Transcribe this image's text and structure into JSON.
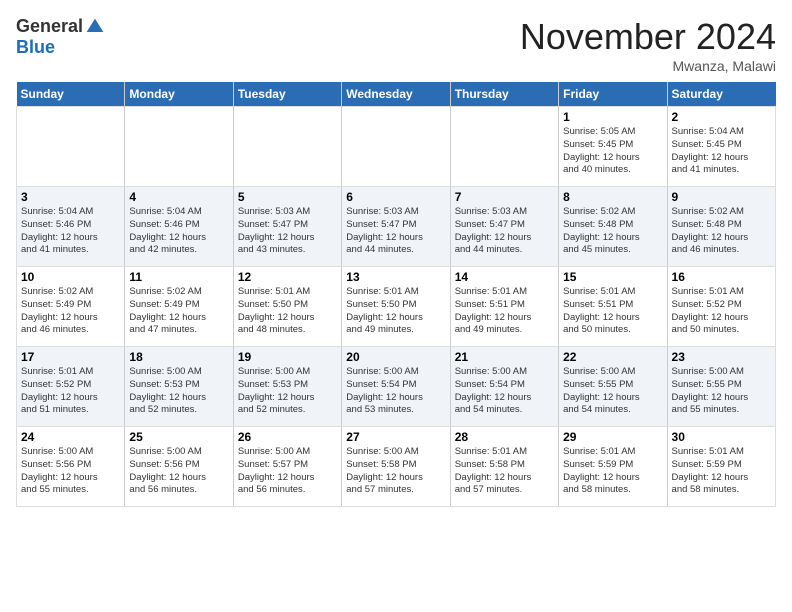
{
  "header": {
    "logo_general": "General",
    "logo_blue": "Blue",
    "month_title": "November 2024",
    "location": "Mwanza, Malawi"
  },
  "weekdays": [
    "Sunday",
    "Monday",
    "Tuesday",
    "Wednesday",
    "Thursday",
    "Friday",
    "Saturday"
  ],
  "weeks": [
    [
      {
        "day": "",
        "info": ""
      },
      {
        "day": "",
        "info": ""
      },
      {
        "day": "",
        "info": ""
      },
      {
        "day": "",
        "info": ""
      },
      {
        "day": "",
        "info": ""
      },
      {
        "day": "1",
        "info": "Sunrise: 5:05 AM\nSunset: 5:45 PM\nDaylight: 12 hours\nand 40 minutes."
      },
      {
        "day": "2",
        "info": "Sunrise: 5:04 AM\nSunset: 5:45 PM\nDaylight: 12 hours\nand 41 minutes."
      }
    ],
    [
      {
        "day": "3",
        "info": "Sunrise: 5:04 AM\nSunset: 5:46 PM\nDaylight: 12 hours\nand 41 minutes."
      },
      {
        "day": "4",
        "info": "Sunrise: 5:04 AM\nSunset: 5:46 PM\nDaylight: 12 hours\nand 42 minutes."
      },
      {
        "day": "5",
        "info": "Sunrise: 5:03 AM\nSunset: 5:47 PM\nDaylight: 12 hours\nand 43 minutes."
      },
      {
        "day": "6",
        "info": "Sunrise: 5:03 AM\nSunset: 5:47 PM\nDaylight: 12 hours\nand 44 minutes."
      },
      {
        "day": "7",
        "info": "Sunrise: 5:03 AM\nSunset: 5:47 PM\nDaylight: 12 hours\nand 44 minutes."
      },
      {
        "day": "8",
        "info": "Sunrise: 5:02 AM\nSunset: 5:48 PM\nDaylight: 12 hours\nand 45 minutes."
      },
      {
        "day": "9",
        "info": "Sunrise: 5:02 AM\nSunset: 5:48 PM\nDaylight: 12 hours\nand 46 minutes."
      }
    ],
    [
      {
        "day": "10",
        "info": "Sunrise: 5:02 AM\nSunset: 5:49 PM\nDaylight: 12 hours\nand 46 minutes."
      },
      {
        "day": "11",
        "info": "Sunrise: 5:02 AM\nSunset: 5:49 PM\nDaylight: 12 hours\nand 47 minutes."
      },
      {
        "day": "12",
        "info": "Sunrise: 5:01 AM\nSunset: 5:50 PM\nDaylight: 12 hours\nand 48 minutes."
      },
      {
        "day": "13",
        "info": "Sunrise: 5:01 AM\nSunset: 5:50 PM\nDaylight: 12 hours\nand 49 minutes."
      },
      {
        "day": "14",
        "info": "Sunrise: 5:01 AM\nSunset: 5:51 PM\nDaylight: 12 hours\nand 49 minutes."
      },
      {
        "day": "15",
        "info": "Sunrise: 5:01 AM\nSunset: 5:51 PM\nDaylight: 12 hours\nand 50 minutes."
      },
      {
        "day": "16",
        "info": "Sunrise: 5:01 AM\nSunset: 5:52 PM\nDaylight: 12 hours\nand 50 minutes."
      }
    ],
    [
      {
        "day": "17",
        "info": "Sunrise: 5:01 AM\nSunset: 5:52 PM\nDaylight: 12 hours\nand 51 minutes."
      },
      {
        "day": "18",
        "info": "Sunrise: 5:00 AM\nSunset: 5:53 PM\nDaylight: 12 hours\nand 52 minutes."
      },
      {
        "day": "19",
        "info": "Sunrise: 5:00 AM\nSunset: 5:53 PM\nDaylight: 12 hours\nand 52 minutes."
      },
      {
        "day": "20",
        "info": "Sunrise: 5:00 AM\nSunset: 5:54 PM\nDaylight: 12 hours\nand 53 minutes."
      },
      {
        "day": "21",
        "info": "Sunrise: 5:00 AM\nSunset: 5:54 PM\nDaylight: 12 hours\nand 54 minutes."
      },
      {
        "day": "22",
        "info": "Sunrise: 5:00 AM\nSunset: 5:55 PM\nDaylight: 12 hours\nand 54 minutes."
      },
      {
        "day": "23",
        "info": "Sunrise: 5:00 AM\nSunset: 5:55 PM\nDaylight: 12 hours\nand 55 minutes."
      }
    ],
    [
      {
        "day": "24",
        "info": "Sunrise: 5:00 AM\nSunset: 5:56 PM\nDaylight: 12 hours\nand 55 minutes."
      },
      {
        "day": "25",
        "info": "Sunrise: 5:00 AM\nSunset: 5:56 PM\nDaylight: 12 hours\nand 56 minutes."
      },
      {
        "day": "26",
        "info": "Sunrise: 5:00 AM\nSunset: 5:57 PM\nDaylight: 12 hours\nand 56 minutes."
      },
      {
        "day": "27",
        "info": "Sunrise: 5:00 AM\nSunset: 5:58 PM\nDaylight: 12 hours\nand 57 minutes."
      },
      {
        "day": "28",
        "info": "Sunrise: 5:01 AM\nSunset: 5:58 PM\nDaylight: 12 hours\nand 57 minutes."
      },
      {
        "day": "29",
        "info": "Sunrise: 5:01 AM\nSunset: 5:59 PM\nDaylight: 12 hours\nand 58 minutes."
      },
      {
        "day": "30",
        "info": "Sunrise: 5:01 AM\nSunset: 5:59 PM\nDaylight: 12 hours\nand 58 minutes."
      }
    ]
  ]
}
